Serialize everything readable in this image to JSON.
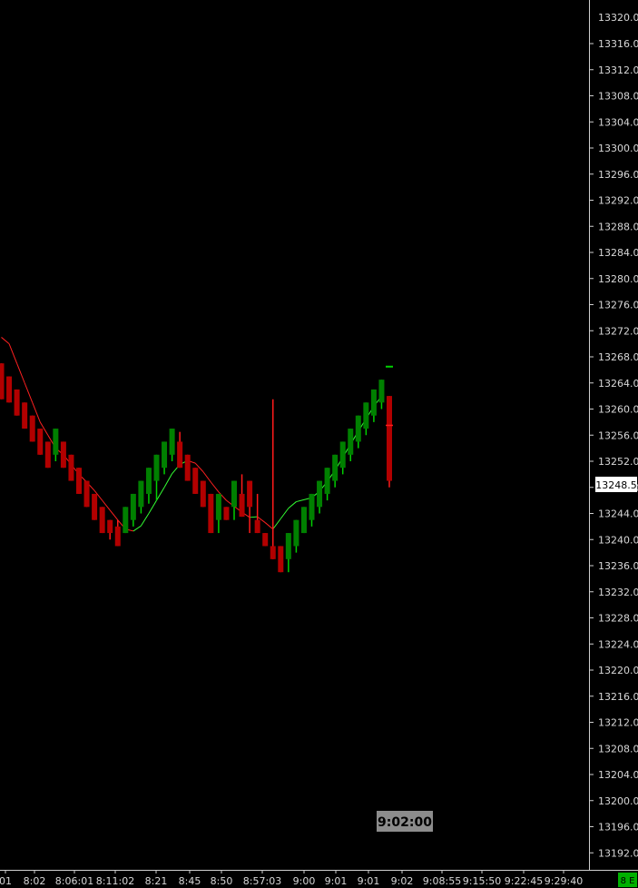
{
  "chart_data": {
    "type": "candlestick",
    "y_axis": {
      "ylim": [
        13189.0,
        13322.5
      ],
      "ticks": [
        13316.0,
        13312.0,
        13308.0,
        13304.0,
        13300.0,
        13296.0,
        13292.0,
        13288.0,
        13284.0,
        13280.0,
        13276.0,
        13272.0,
        13268.0,
        13264.0,
        13260.0,
        13256.0,
        13252.0,
        13248.0,
        13244.0,
        13240.0,
        13236.0,
        13232.0,
        13228.0,
        13224.0,
        13220.0,
        13216.0,
        13212.0,
        13208.0,
        13204.0,
        13200.0,
        13196.0,
        13192.0
      ],
      "partial_top_tick": "13320.0"
    },
    "x_axis": {
      "ticks": [
        "01",
        "8:02",
        "8:06:01",
        "8:11:02",
        "8:21",
        "8:45",
        "8:50",
        "8:57:03",
        "9:00",
        "9:01",
        "9:01",
        "9:02",
        "9:08:55",
        "9:15:50",
        "9:22:45",
        "9:29:40"
      ]
    },
    "current_price": "13248.5",
    "time_marker": "9:02:00",
    "corner_label": "8 E",
    "colors": {
      "up": "#008000",
      "up_wick": "#00d000",
      "down": "#b20000",
      "down_wick": "#ff1a1a",
      "ma_down": "#ff2020",
      "ma_up": "#33ff33",
      "axis_text": "#d8d8d8",
      "background": "#000000",
      "price_tag_bg": "#ffffff",
      "time_tag_bg": "#8c8c8c",
      "corner_bg": "#00b000"
    },
    "candles": [
      {
        "o": 13267.0,
        "h": 13267.0,
        "l": 13261.5,
        "c": 13261.5
      },
      {
        "o": 13265.0,
        "h": 13265.0,
        "l": 13261.0,
        "c": 13261.0
      },
      {
        "o": 13263.0,
        "h": 13263.0,
        "l": 13259.0,
        "c": 13259.0
      },
      {
        "o": 13261.0,
        "h": 13261.0,
        "l": 13257.0,
        "c": 13257.0
      },
      {
        "o": 13259.0,
        "h": 13259.0,
        "l": 13255.0,
        "c": 13255.0
      },
      {
        "o": 13257.0,
        "h": 13257.0,
        "l": 13253.0,
        "c": 13253.0
      },
      {
        "o": 13255.0,
        "h": 13255.0,
        "l": 13251.0,
        "c": 13251.0
      },
      {
        "o": 13253.0,
        "h": 13257.0,
        "l": 13252.0,
        "c": 13257.0
      },
      {
        "o": 13255.0,
        "h": 13255.0,
        "l": 13251.0,
        "c": 13251.0
      },
      {
        "o": 13253.0,
        "h": 13253.0,
        "l": 13249.0,
        "c": 13249.0
      },
      {
        "o": 13251.0,
        "h": 13251.0,
        "l": 13247.0,
        "c": 13247.0
      },
      {
        "o": 13249.0,
        "h": 13249.0,
        "l": 13245.0,
        "c": 13245.0
      },
      {
        "o": 13247.0,
        "h": 13247.0,
        "l": 13243.0,
        "c": 13243.0
      },
      {
        "o": 13245.0,
        "h": 13245.0,
        "l": 13241.0,
        "c": 13241.0
      },
      {
        "o": 13243.0,
        "h": 13243.0,
        "l": 13240.0,
        "c": 13241.0
      },
      {
        "o": 13242.0,
        "h": 13243.0,
        "l": 13239.0,
        "c": 13239.0
      },
      {
        "o": 13241.0,
        "h": 13245.0,
        "l": 13241.0,
        "c": 13245.0
      },
      {
        "o": 13243.0,
        "h": 13247.0,
        "l": 13242.0,
        "c": 13247.0
      },
      {
        "o": 13245.0,
        "h": 13249.0,
        "l": 13244.0,
        "c": 13249.0
      },
      {
        "o": 13247.0,
        "h": 13251.0,
        "l": 13245.5,
        "c": 13251.0
      },
      {
        "o": 13249.0,
        "h": 13253.0,
        "l": 13246.0,
        "c": 13253.0
      },
      {
        "o": 13251.0,
        "h": 13255.0,
        "l": 13250.0,
        "c": 13255.0
      },
      {
        "o": 13253.0,
        "h": 13257.0,
        "l": 13252.0,
        "c": 13257.0
      },
      {
        "o": 13255.0,
        "h": 13256.5,
        "l": 13251.0,
        "c": 13251.0
      },
      {
        "o": 13253.0,
        "h": 13253.0,
        "l": 13249.0,
        "c": 13249.0
      },
      {
        "o": 13251.0,
        "h": 13251.0,
        "l": 13247.0,
        "c": 13247.0
      },
      {
        "o": 13249.0,
        "h": 13249.0,
        "l": 13245.0,
        "c": 13245.0
      },
      {
        "o": 13247.0,
        "h": 13247.0,
        "l": 13241.0,
        "c": 13241.0
      },
      {
        "o": 13243.0,
        "h": 13247.0,
        "l": 13241.0,
        "c": 13247.0
      },
      {
        "o": 13245.0,
        "h": 13245.0,
        "l": 13243.0,
        "c": 13243.0
      },
      {
        "o": 13245.0,
        "h": 13249.0,
        "l": 13243.0,
        "c": 13249.0
      },
      {
        "o": 13247.0,
        "h": 13250.0,
        "l": 13243.5,
        "c": 13243.5
      },
      {
        "o": 13249.0,
        "h": 13249.0,
        "l": 13241.0,
        "c": 13245.0
      },
      {
        "o": 13243.0,
        "h": 13247.0,
        "l": 13241.0,
        "c": 13241.0
      },
      {
        "o": 13241.0,
        "h": 13241.0,
        "l": 13239.0,
        "c": 13239.0
      },
      {
        "o": 13239.0,
        "h": 13261.5,
        "l": 13237.0,
        "c": 13237.0
      },
      {
        "o": 13239.0,
        "h": 13239.0,
        "l": 13235.0,
        "c": 13235.0
      },
      {
        "o": 13237.0,
        "h": 13241.0,
        "l": 13235.0,
        "c": 13241.0
      },
      {
        "o": 13239.0,
        "h": 13243.0,
        "l": 13238.0,
        "c": 13243.0
      },
      {
        "o": 13241.0,
        "h": 13245.0,
        "l": 13241.0,
        "c": 13245.0
      },
      {
        "o": 13243.0,
        "h": 13247.0,
        "l": 13242.0,
        "c": 13247.0
      },
      {
        "o": 13245.0,
        "h": 13249.0,
        "l": 13244.0,
        "c": 13249.0
      },
      {
        "o": 13247.0,
        "h": 13251.0,
        "l": 13246.0,
        "c": 13251.0
      },
      {
        "o": 13249.0,
        "h": 13253.0,
        "l": 13248.0,
        "c": 13253.0
      },
      {
        "o": 13251.0,
        "h": 13255.0,
        "l": 13250.0,
        "c": 13255.0
      },
      {
        "o": 13253.0,
        "h": 13257.0,
        "l": 13252.0,
        "c": 13257.0
      },
      {
        "o": 13255.0,
        "h": 13259.0,
        "l": 13254.0,
        "c": 13259.0
      },
      {
        "o": 13257.0,
        "h": 13261.0,
        "l": 13256.0,
        "c": 13261.0
      },
      {
        "o": 13259.0,
        "h": 13263.0,
        "l": 13258.0,
        "c": 13263.0
      },
      {
        "o": 13261.0,
        "h": 13264.5,
        "l": 13260.0,
        "c": 13264.5
      },
      {
        "o": 13262.0,
        "h": 13262.0,
        "l": 13248.0,
        "c": 13249.0
      }
    ],
    "ghost_marks": [
      {
        "price": 13266.5,
        "kind": "up-tick"
      },
      {
        "price": 13257.5,
        "kind": "down-cross"
      }
    ],
    "moving_average": [
      13271,
      13270,
      13267,
      13264,
      13261,
      13258,
      13256,
      13254,
      13253,
      13251.5,
      13250,
      13248.8,
      13247.5,
      13246,
      13244.5,
      13243,
      13241.6,
      13241.3,
      13242.1,
      13244,
      13246,
      13248,
      13250.1,
      13251.5,
      13252.1,
      13251.7,
      13250.4,
      13248.8,
      13247.3,
      13246,
      13245.1,
      13244.2,
      13243.4,
      13243.5,
      13242.6,
      13241.6,
      13243.2,
      13244.8,
      13245.8,
      13246.1,
      13246.4,
      13247.4,
      13248.9,
      13250.6,
      13252.6,
      13254.6,
      13256.6,
      13258.5,
      13260.4,
      13262.0
    ]
  }
}
